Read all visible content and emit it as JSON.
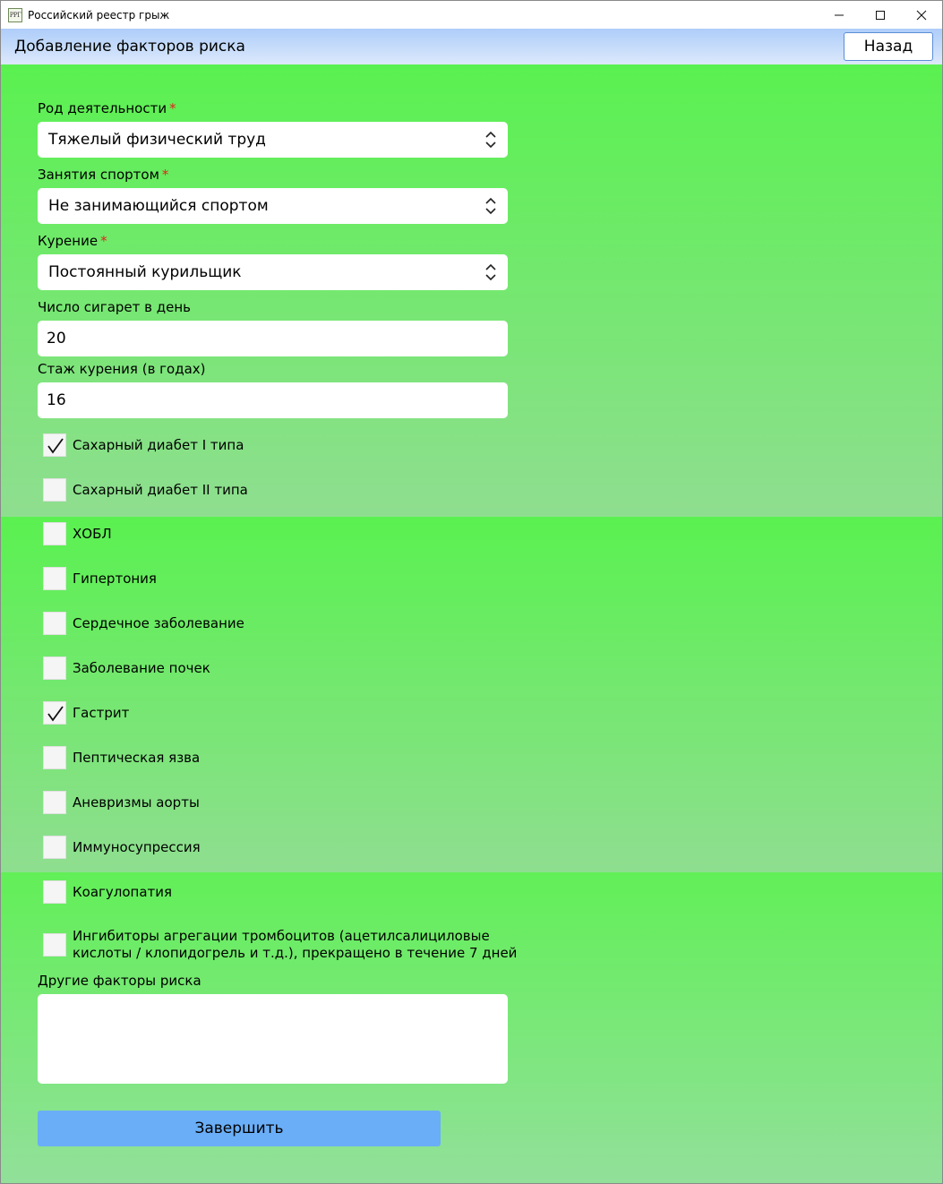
{
  "window": {
    "title": "Российский реестр грыж",
    "icon_text": "РРГ",
    "minimize_label": "—",
    "maximize_label": "☐",
    "close_label": "✕"
  },
  "header": {
    "title": "Добавление факторов риска",
    "back_label": "Назад"
  },
  "form": {
    "occupation": {
      "label": "Род деятельности",
      "required_mark": "*",
      "value": "Тяжелый физический труд"
    },
    "sport": {
      "label": "Занятия спортом",
      "required_mark": "*",
      "value": "Не занимающийся спортом"
    },
    "smoking": {
      "label": "Курение",
      "required_mark": "*",
      "value": "Постоянный курильщик"
    },
    "cigarettes": {
      "label": "Число сигарет в день",
      "value": "20"
    },
    "smoking_years": {
      "label": "Стаж курения (в годах)",
      "value": "16"
    },
    "checkboxes": [
      {
        "label": "Сахарный диабет I типа",
        "checked": true
      },
      {
        "label": "Сахарный диабет II типа",
        "checked": false
      },
      {
        "label": "ХОБЛ",
        "checked": false
      },
      {
        "label": "Гипертония",
        "checked": false
      },
      {
        "label": "Сердечное заболевание",
        "checked": false
      },
      {
        "label": "Заболевание почек",
        "checked": false
      },
      {
        "label": "Гастрит",
        "checked": true
      },
      {
        "label": "Пептическая язва",
        "checked": false
      },
      {
        "label": "Аневризмы аорты",
        "checked": false
      },
      {
        "label": "Иммуносупрессия",
        "checked": false
      },
      {
        "label": "Коагулопатия",
        "checked": false
      },
      {
        "label_line1": "Ингибиторы агрегации тромбоцитов (ацетилсалициловые",
        "label_line2": "кислоты / клопидогрель и т.д.), прекращено в течение 7 дней",
        "checked": false
      }
    ],
    "other": {
      "label": "Другие факторы риска",
      "value": ""
    },
    "finish_label": "Завершить"
  }
}
